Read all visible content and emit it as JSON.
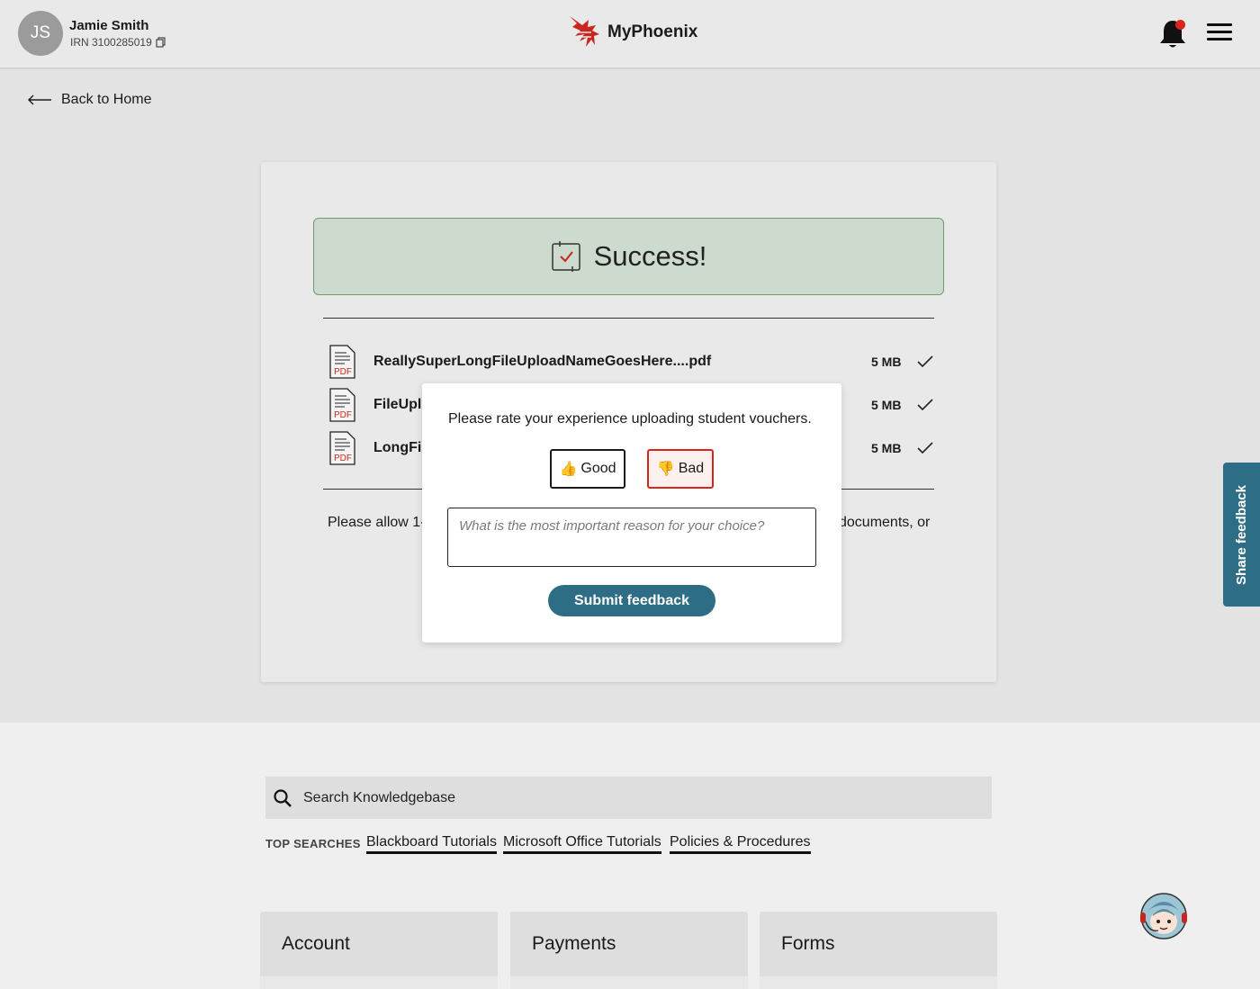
{
  "header": {
    "avatar_initials": "JS",
    "user_name": "Jamie Smith",
    "irn": "IRN 3100285019",
    "brand_name": "MyPhoenix",
    "brand_color": "#c8261e",
    "notification_icon": "bell-icon",
    "menu_icon": "hamburger-icon"
  },
  "back_link": "Back to Home",
  "success": {
    "title": "Success!",
    "background": "#ccdbcd"
  },
  "files": [
    {
      "name": "ReallySuperLongFileUploadNameGoesHere....pdf",
      "size": "5 MB"
    },
    {
      "name": "FileUplo",
      "size": "5 MB"
    },
    {
      "name": "LongFil",
      "size": "5 MB"
    }
  ],
  "allow_text_left": "Please allow 1-",
  "allow_text_right": "documents, or",
  "modal": {
    "question": "Please rate your experience uploading student vouchers.",
    "good_label": "Good",
    "bad_label": "Bad",
    "reason_placeholder": "What is the most important reason for your choice?",
    "submit_label": "Submit feedback"
  },
  "share_feedback": "Share feedback",
  "knowledgebase": {
    "search_placeholder": "Search Knowledgebase",
    "top_searches_label": "TOP SEARCHES",
    "top_searches": [
      "Blackboard Tutorials",
      "Microsoft Office Tutorials",
      "Policies & Procedures"
    ]
  },
  "tiles": [
    "Account",
    "Payments",
    "Forms"
  ],
  "colors": {
    "accent": "#2d6e86",
    "alert": "#d9261c"
  }
}
